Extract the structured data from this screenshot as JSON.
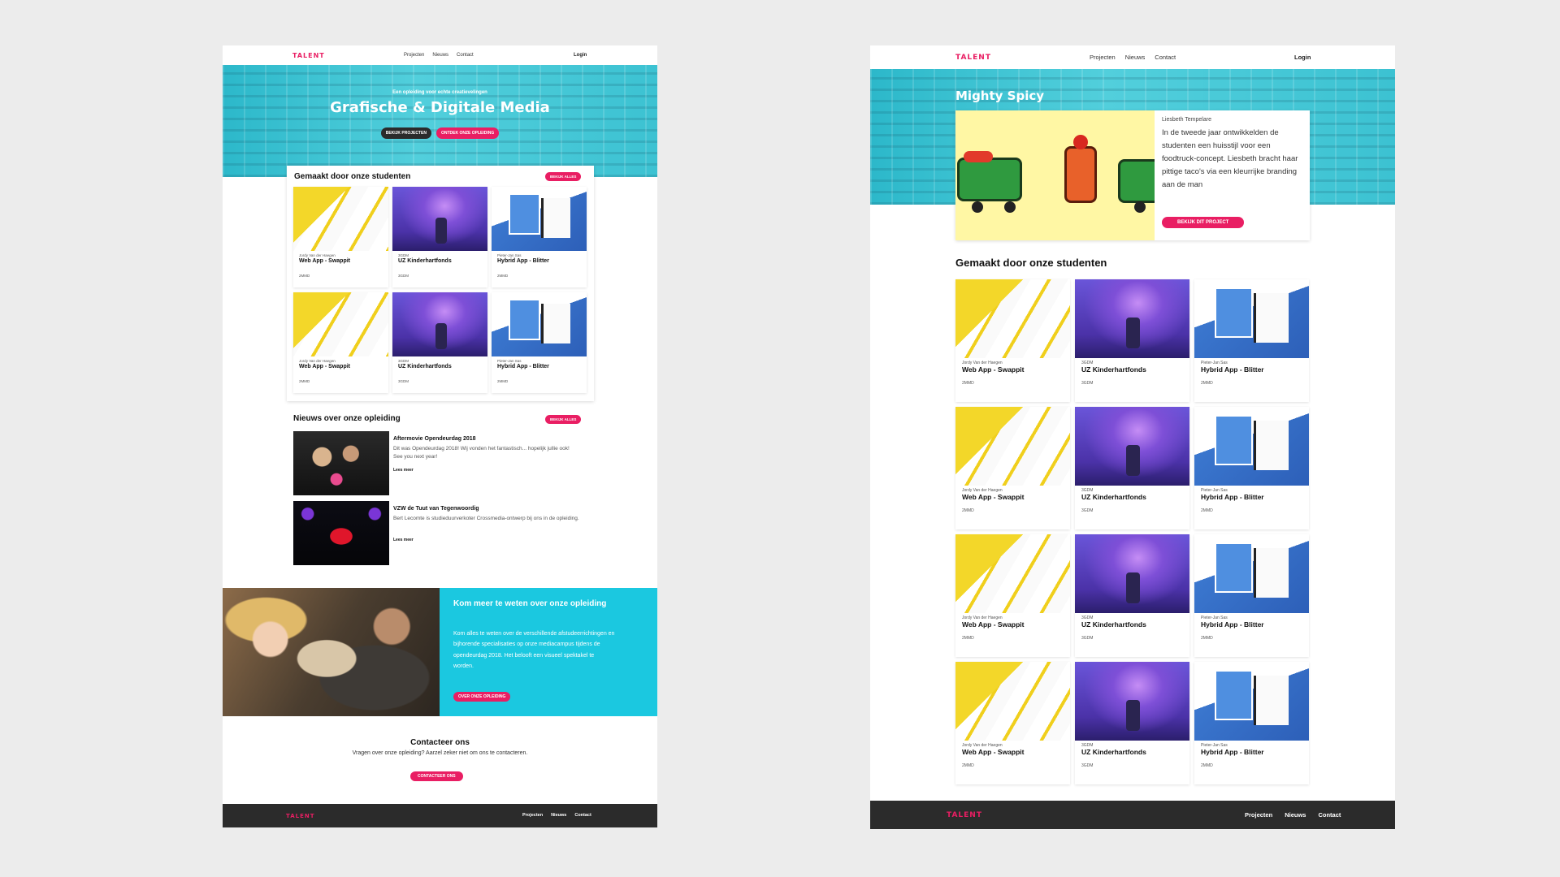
{
  "colors": {
    "accent": "#e91e63",
    "hero": "#3ec6d6",
    "info_panel": "#1bc8e0",
    "footer": "#2b2b2b",
    "background": "#ececec"
  },
  "brand": "TALENT",
  "nav": {
    "items": [
      "Projecten",
      "Nieuws",
      "Contact"
    ],
    "login": "Login"
  },
  "home": {
    "hero": {
      "tagline": "Een opleiding voor echte creatievelingen",
      "title": "Grafische & Digitale Media",
      "btn_projects": "BEKIJK PROJECTEN",
      "btn_discover": "ONTDEK ONZE OPLEIDING"
    },
    "projects": {
      "heading": "Gemaakt door onze studenten",
      "button": "BEKIJK ALLES"
    },
    "news": {
      "heading": "Nieuws over onze opleiding",
      "button": "BEKIJK ALLES",
      "items": [
        {
          "title": "Aftermovie Opendeurdag 2018",
          "text": "Dit was Opendeurdag 2018! Wij vonden het fantastisch... hopelijk jullie ook! See you next year!",
          "more": "Lees meer"
        },
        {
          "title": "VZW de Tuut van Tegenwoordig",
          "text": "Bert Lecomte is studieduurverkoter Crossmedia-ontwerp bij ons in de opleiding.",
          "more": "Lees meer"
        }
      ]
    },
    "info": {
      "title": "Kom meer te weten over onze opleiding",
      "text": "Kom alles te weten over de verschillende afstudeerrichtingen en bijhorende specialisaties op onze mediacampus tijdens de opendeurdag 2018. Het belooft een visueel spektakel te worden.",
      "button": "OVER ONZE OPLEIDING"
    },
    "contact": {
      "title": "Contacteer ons",
      "subtitle": "Vragen over onze opleiding? Aarzel zeker niet om ons te contacteren.",
      "button": "CONTACTEER ONS"
    }
  },
  "project": {
    "title": "Mighty Spicy",
    "author": "Liesbeth Tempelare",
    "text": "In de tweede jaar ontwikkelden de studenten een huisstijl voor een foodtruck-concept. Liesbeth bracht haar pittige taco's via een kleurrijke branding aan de man",
    "button": "BEKIJK DIT PROJECT",
    "projects_heading": "Gemaakt door onze studenten"
  },
  "cards": [
    {
      "author": "Jordy Van der Haegen",
      "title": "Web App - Swappit",
      "tag": "2MMD",
      "thumb": "yellow"
    },
    {
      "author": "3GDM",
      "title": "UZ Kinderhartfonds",
      "tag": "3GDM",
      "thumb": "purple"
    },
    {
      "author": "Pieter-Jan Sas",
      "title": "Hybrid App - Blitter",
      "tag": "2MMD",
      "thumb": "blue"
    }
  ]
}
